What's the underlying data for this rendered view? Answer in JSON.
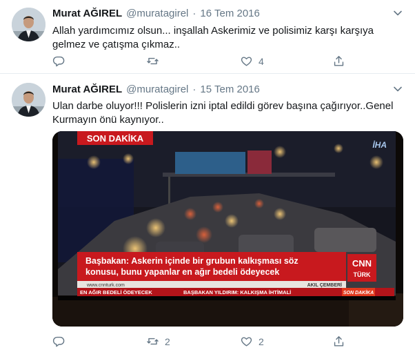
{
  "tweets": [
    {
      "name": "Murat AĞIREL",
      "handle": "@muratagirel",
      "separator": "·",
      "date": "16 Tem 2016",
      "text": "Allah yardımcımız olsun... inşallah Askerimiz ve polisimiz karşı karşıya gelmez ve çatışma çıkmaz..",
      "replies": "",
      "retweets": "",
      "likes": "4"
    },
    {
      "name": "Murat AĞIREL",
      "handle": "@muratagirel",
      "separator": "·",
      "date": "15 Tem 2016",
      "text": "Ulan darbe oluyor!!! Polislerin izni iptal edildi görev başına çağırıyor..Genel Kurmayın önü kaynıyor..",
      "replies": "",
      "retweets": "2",
      "likes": "2",
      "media": {
        "son_dakika_tag": "SON DAKİKA",
        "iha_logo": "İHA",
        "headline_line1": "Başbakan: Askerin içinde bir grubun kalkışması söz",
        "headline_line2": "konusu, bunu yapanlar en ağır bedeli ödeyecek",
        "site": "www.cnnturk.com",
        "program": "AKIL ÇEMBERİ",
        "network_logo_top": "CNN",
        "network_logo_bottom": "TÜRK",
        "ticker_left": "EN AĞIR BEDELİ ÖDEYECEK",
        "ticker_middle": "BAŞBAKAN YILDIRIM: KALKIŞMA İHTİMALİ",
        "ticker_right": "SON DAKİKA"
      }
    }
  ],
  "colors": {
    "text": "#14171a",
    "muted": "#657786",
    "divider": "#e6ecf0",
    "news_red": "#c8191e"
  },
  "icons": [
    "reply-icon",
    "retweet-icon",
    "like-icon",
    "share-icon",
    "chevron-down-icon"
  ]
}
